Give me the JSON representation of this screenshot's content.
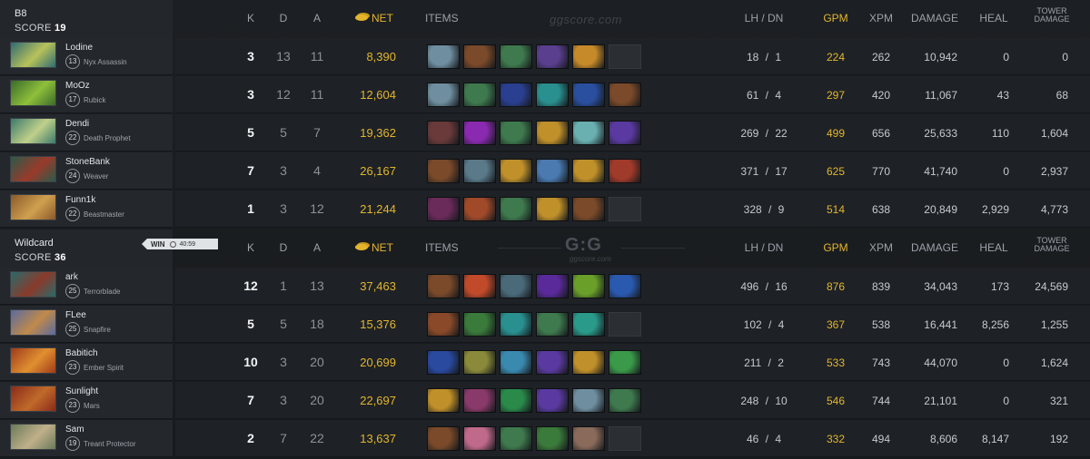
{
  "columns": {
    "k": "K",
    "d": "D",
    "a": "A",
    "net": "NET",
    "items": "ITEMS",
    "lhdn": "LH  /  DN",
    "gpm": "GPM",
    "xpm": "XPM",
    "damage": "DAMAGE",
    "heal": "HEAL",
    "tower_line1": "TOWER",
    "tower_line2": "DAMAGE"
  },
  "watermark": {
    "site": "ggscore.com",
    "logo": "G:G",
    "logo_sub": "ggscore.com"
  },
  "teams": [
    {
      "name": "B8",
      "score_label": "SCORE",
      "score": "19",
      "players": [
        {
          "name": "Lodine",
          "level": "13",
          "hero": "Nyx Assassin",
          "k": "3",
          "d": "13",
          "a": "11",
          "net": "8,390",
          "lhdn": "18 / 1",
          "gpm": "224",
          "xpm": "262",
          "damage": "10,942",
          "heal": "0",
          "tower": "0",
          "portrait": [
            "#2f6b72",
            "#b8c25a"
          ],
          "items": [
            "#6f8fa0",
            "#7a4a2a",
            "#3f7a4e",
            "#5a3f8f",
            "#c68a2a",
            "empty"
          ]
        },
        {
          "name": "MoOz",
          "level": "17",
          "hero": "Rubick",
          "k": "3",
          "d": "12",
          "a": "11",
          "net": "12,604",
          "lhdn": "61 / 4",
          "gpm": "297",
          "xpm": "420",
          "damage": "11,067",
          "heal": "43",
          "tower": "68",
          "portrait": [
            "#3a6b2a",
            "#8fbf3a"
          ],
          "items": [
            "#6f8fa0",
            "#3f7a4e",
            "#2a3f8f",
            "#2a8f8f",
            "#2a4f9f",
            "#7a4a2a"
          ]
        },
        {
          "name": "Dendi",
          "level": "22",
          "hero": "Death Prophet",
          "k": "5",
          "d": "5",
          "a": "7",
          "net": "19,362",
          "lhdn": "269 / 22",
          "gpm": "499",
          "xpm": "656",
          "damage": "25,633",
          "heal": "110",
          "tower": "1,604",
          "portrait": [
            "#3b7a6a",
            "#c0d08a"
          ],
          "items": [
            "#6a3a3a",
            "#8a2ab0",
            "#3f7a4e",
            "#c0902a",
            "#6ab0b0",
            "#5a3aa0"
          ]
        },
        {
          "name": "StoneBank",
          "level": "24",
          "hero": "Weaver",
          "k": "7",
          "d": "3",
          "a": "4",
          "net": "26,167",
          "lhdn": "371 / 17",
          "gpm": "625",
          "xpm": "770",
          "damage": "41,740",
          "heal": "0",
          "tower": "2,937",
          "portrait": [
            "#2a5a4a",
            "#9a3a2a"
          ],
          "items": [
            "#7a4a2a",
            "#5a7a8a",
            "#c0902a",
            "#4a7ab0",
            "#c0902a",
            "#a03a2a"
          ]
        },
        {
          "name": "Funn1k",
          "level": "22",
          "hero": "Beastmaster",
          "k": "1",
          "d": "3",
          "a": "12",
          "net": "21,244",
          "lhdn": "328 / 9",
          "gpm": "514",
          "xpm": "638",
          "damage": "20,849",
          "heal": "2,929",
          "tower": "4,773",
          "portrait": [
            "#8a5a2a",
            "#d0a050"
          ],
          "items": [
            "#6a2a5a",
            "#a04a2a",
            "#3f7a4e",
            "#c0902a",
            "#7a4a2a",
            "empty"
          ]
        }
      ]
    },
    {
      "name": "Wildcard",
      "score_label": "SCORE",
      "score": "36",
      "win_label": "WIN",
      "duration": "40:59",
      "players": [
        {
          "name": "ark",
          "level": "25",
          "hero": "Terrorblade",
          "k": "12",
          "d": "1",
          "a": "13",
          "net": "37,463",
          "lhdn": "496 / 16",
          "gpm": "876",
          "xpm": "839",
          "damage": "34,043",
          "heal": "173",
          "tower": "24,569",
          "portrait": [
            "#2a6a6a",
            "#8a3a2a"
          ],
          "items": [
            "#7a4a2a",
            "#c04a2a",
            "#4a6a7a",
            "#5a2a9a",
            "#6aa02a",
            "#2a5ab0"
          ]
        },
        {
          "name": "FLee",
          "level": "25",
          "hero": "Snapfire",
          "k": "5",
          "d": "5",
          "a": "18",
          "net": "15,376",
          "lhdn": "102 / 4",
          "gpm": "367",
          "xpm": "538",
          "damage": "16,441",
          "heal": "8,256",
          "tower": "1,255",
          "portrait": [
            "#5a6aa0",
            "#c08a4a"
          ],
          "items": [
            "#8a4a2a",
            "#3a7a3a",
            "#2a8f8f",
            "#3f7a4e",
            "#2a9a8a",
            "empty"
          ]
        },
        {
          "name": "Babitich",
          "level": "23",
          "hero": "Ember Spirit",
          "k": "10",
          "d": "3",
          "a": "20",
          "net": "20,699",
          "lhdn": "211 / 2",
          "gpm": "533",
          "xpm": "743",
          "damage": "44,070",
          "heal": "0",
          "tower": "1,624",
          "portrait": [
            "#a03a1a",
            "#e09030"
          ],
          "items": [
            "#2a4aa0",
            "#8a8a3a",
            "#3a8ab0",
            "#5a3aa0",
            "#c0902a",
            "#3a9a4a"
          ]
        },
        {
          "name": "Sunlight",
          "level": "23",
          "hero": "Mars",
          "k": "7",
          "d": "3",
          "a": "20",
          "net": "22,697",
          "lhdn": "248 / 10",
          "gpm": "546",
          "xpm": "744",
          "damage": "21,101",
          "heal": "0",
          "tower": "321",
          "portrait": [
            "#8a2a1a",
            "#c06a2a"
          ],
          "items": [
            "#c0902a",
            "#8a3a6a",
            "#2a8a4a",
            "#5a3aa0",
            "#6f8fa0",
            "#3f7a4e"
          ]
        },
        {
          "name": "Sam",
          "level": "19",
          "hero": "Treant Protector",
          "k": "2",
          "d": "7",
          "a": "22",
          "net": "13,637",
          "lhdn": "46 / 4",
          "gpm": "332",
          "xpm": "494",
          "damage": "8,606",
          "heal": "8,147",
          "tower": "192",
          "portrait": [
            "#6a7a5a",
            "#c0b08a"
          ],
          "items": [
            "#7a4a2a",
            "#c06a8a",
            "#3f7a4e",
            "#3a7a3a",
            "#8a6a5a",
            "empty"
          ]
        }
      ]
    }
  ]
}
